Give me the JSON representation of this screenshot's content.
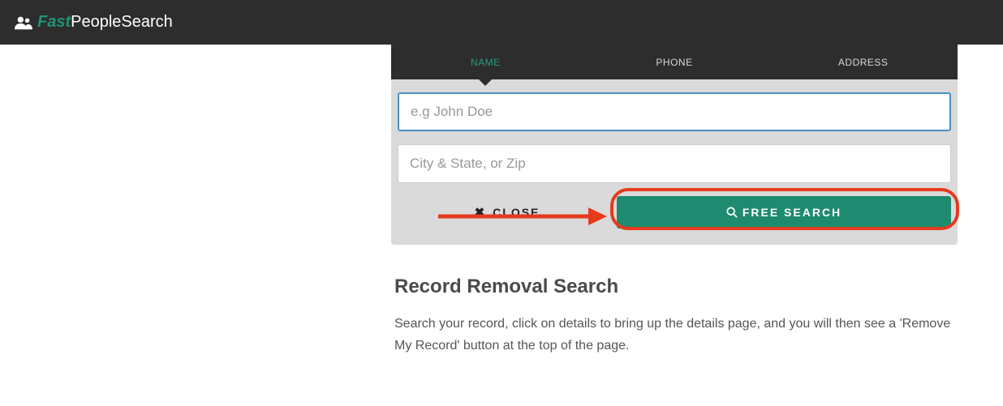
{
  "header": {
    "logo_fast": "Fast",
    "logo_rest": "PeopleSearch"
  },
  "tabs": {
    "name": "NAME",
    "phone": "PHONE",
    "address": "ADDRESS"
  },
  "form": {
    "name_placeholder": "e.g John Doe",
    "location_placeholder": "City & State, or Zip",
    "close_label": "CLOSE",
    "search_label": "FREE SEARCH"
  },
  "content": {
    "heading": "Record Removal Search",
    "body": "Search your record, click on details to bring up the details page, and you will then see a 'Remove My Record' button at the top of the page."
  }
}
